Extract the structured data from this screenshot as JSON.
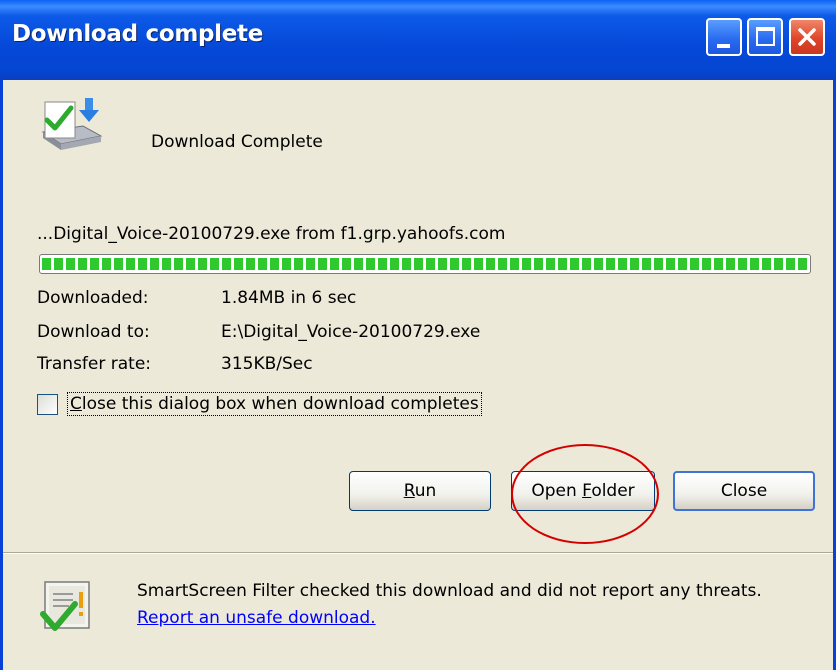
{
  "window": {
    "title": "Download complete"
  },
  "titlebar_buttons": {
    "minimize": "minimize",
    "maximize": "maximize",
    "close": "close"
  },
  "heading": "Download Complete",
  "file": {
    "description": "...Digital_Voice-20100729.exe from f1.grp.yahoofs.com",
    "progress_percent": 100
  },
  "info": {
    "downloaded_label": "Downloaded:",
    "downloaded_value": "1.84MB in 6 sec",
    "download_to_label": "Download to:",
    "download_to_value": "E:\\Digital_Voice-20100729.exe",
    "rate_label": "Transfer rate:",
    "rate_value": "315KB/Sec"
  },
  "option": {
    "close_when_complete_label": "Close this dialog box when download completes",
    "checked": false
  },
  "buttons": {
    "run": "Run",
    "open_folder": "Open Folder",
    "close": "Close"
  },
  "smartscreen": {
    "message": "SmartScreen Filter checked this download and did not report any threats.",
    "link": "Report an unsafe download."
  },
  "colors": {
    "titlebar": "#0548d8",
    "progress": "#2fc92f",
    "annotation_circle": "#d40000",
    "link": "#0000ff"
  },
  "icons": [
    "download-complete-icon",
    "smartscreen-shield-icon",
    "minimize-icon",
    "maximize-icon",
    "close-icon"
  ]
}
